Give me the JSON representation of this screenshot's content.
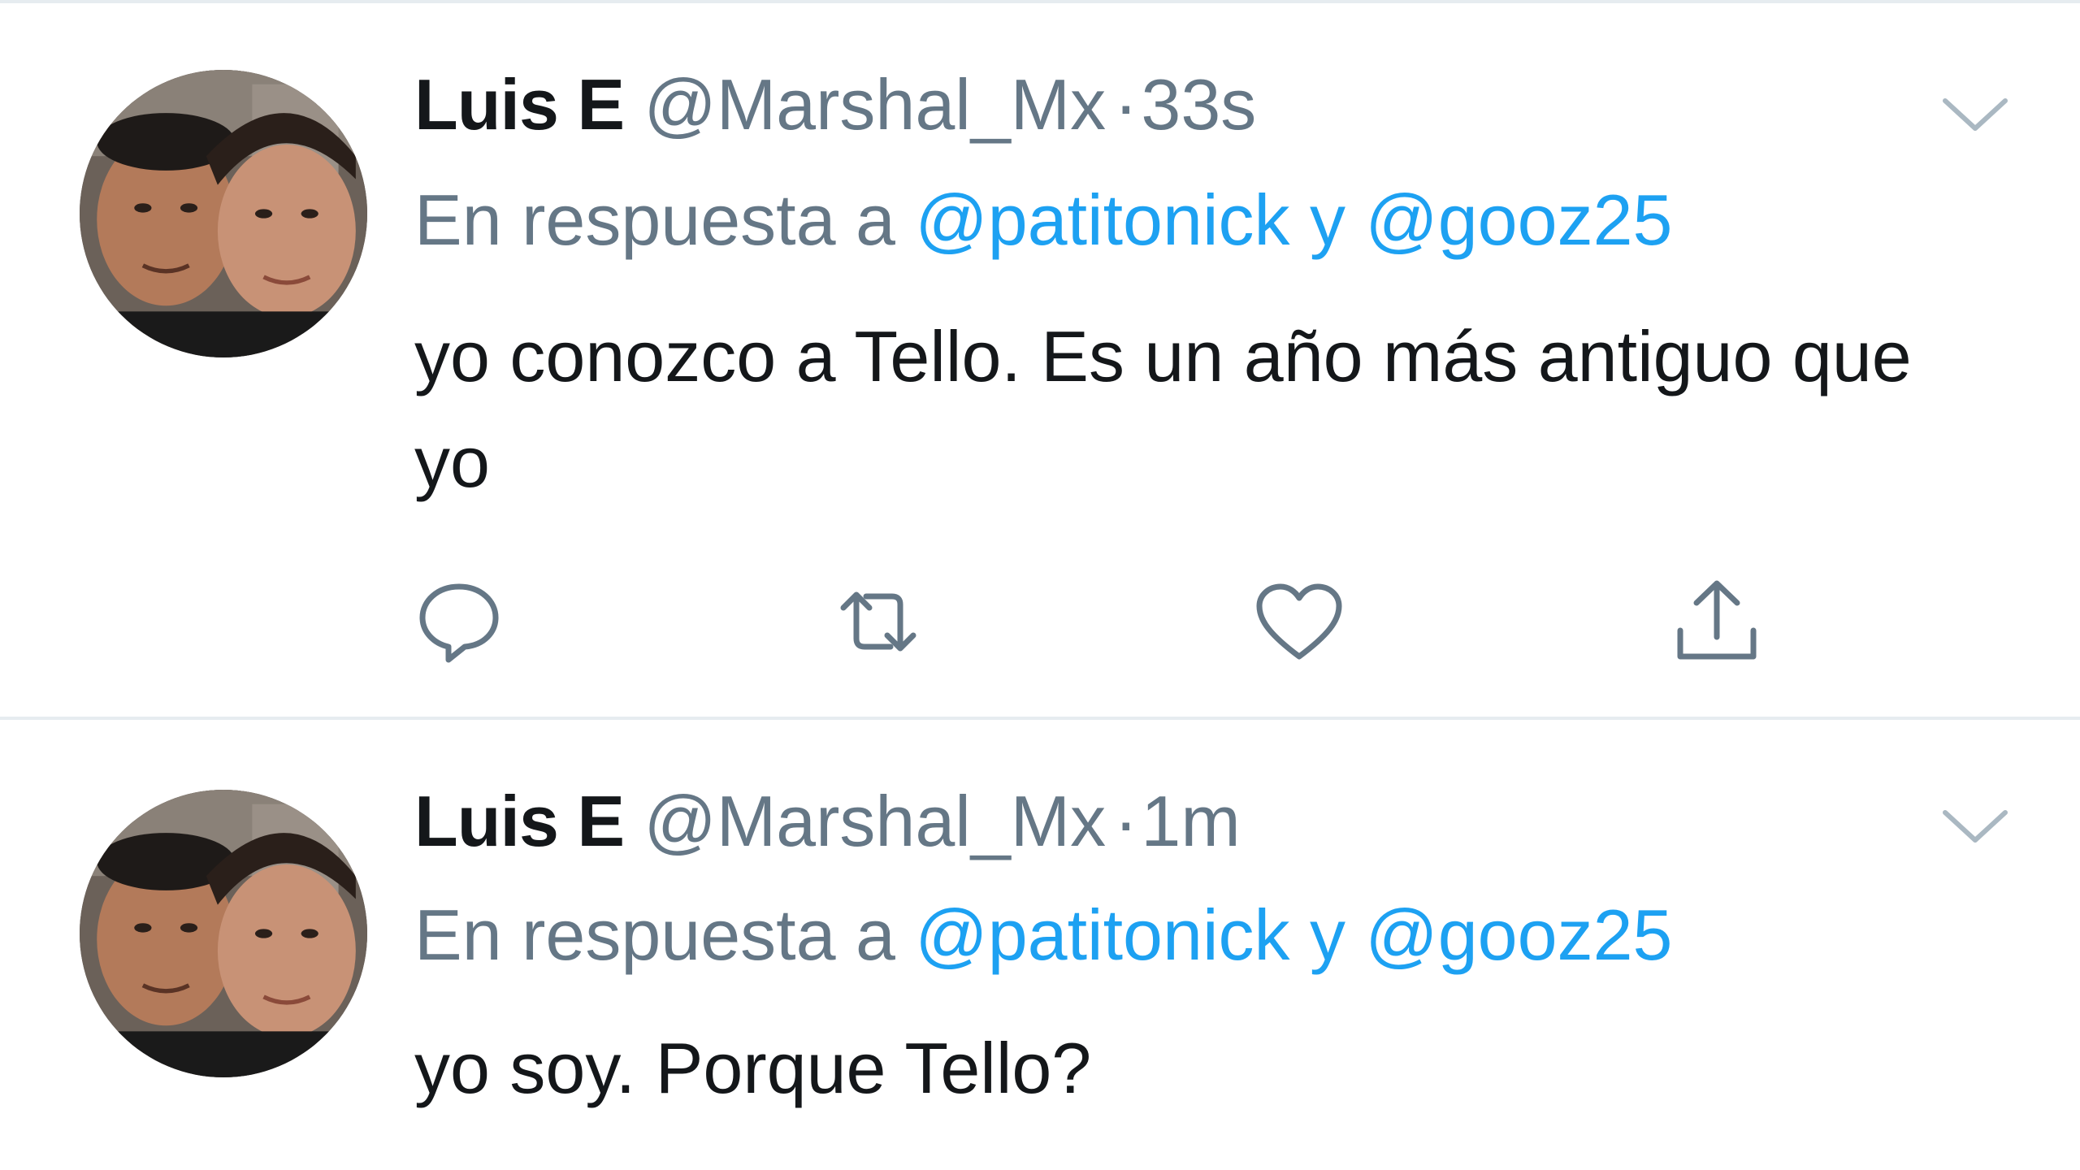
{
  "tweets": [
    {
      "name": "Luis E",
      "handle": "@Marshal_Mx",
      "separator": "·",
      "time": "33s",
      "reply_prefix": "En respuesta a",
      "mention_1": "@patitonick",
      "conjunction": "y",
      "mention_2": "@gooz25",
      "text": "yo conozco a Tello. Es un año más antiguo que yo"
    },
    {
      "name": "Luis E",
      "handle": "@Marshal_Mx",
      "separator": "·",
      "time": "1m",
      "reply_prefix": "En respuesta a",
      "mention_1": "@patitonick",
      "conjunction": "y",
      "mention_2": "@gooz25",
      "text": "yo soy. Porque Tello?"
    }
  ],
  "icons": {
    "reply": "reply-icon",
    "retweet": "retweet-icon",
    "like": "heart-icon",
    "share": "share-icon",
    "more": "chevron-down-icon"
  },
  "colors": {
    "text": "#14171a",
    "secondary": "#657786",
    "link": "#1da1f2",
    "divider": "#e6ecf0"
  }
}
